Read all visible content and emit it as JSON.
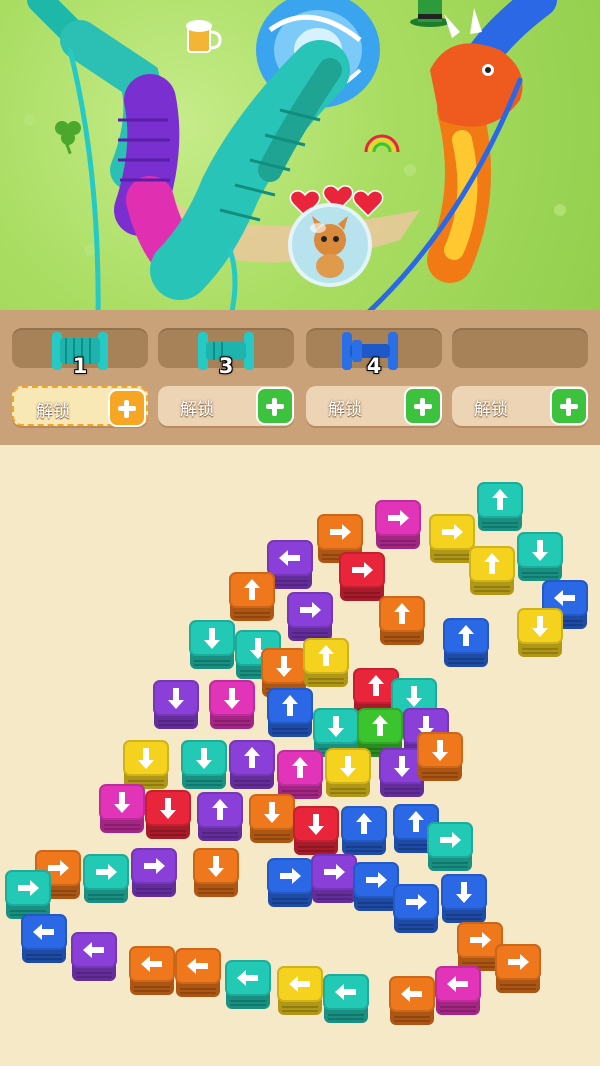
{
  "slots": [
    {
      "number": "1",
      "spool_color": "#26c9c4"
    },
    {
      "number": "3",
      "spool_color": "#26c9c4"
    },
    {
      "number": "4",
      "spool_color": "#2a6fe6"
    },
    {
      "number": "",
      "spool_color": ""
    }
  ],
  "unlock_buttons": [
    {
      "label": "解锁",
      "style": "orange"
    },
    {
      "label": "解锁",
      "style": "green"
    },
    {
      "label": "解锁",
      "style": "green"
    },
    {
      "label": "解锁",
      "style": "green"
    }
  ],
  "scene": {
    "hearts": 3,
    "character": "kitten-in-bubble",
    "decorations": [
      "shamrock-icon",
      "beer-mug-icon",
      "leprechaun-hat-icon",
      "rainbow-icon",
      "portal-swirl",
      "fire-dragon-head"
    ]
  },
  "colors": {
    "orange": "#f0781c",
    "yellow": "#f4d21e",
    "cyan": "#22c9b5",
    "purple": "#8a3fd8",
    "magenta": "#e234b8",
    "red": "#e8253a",
    "blue": "#2a68e6",
    "green": "#3cc42e",
    "arrow": "#ffffff"
  },
  "blocks": [
    {
      "c": "cyan",
      "d": "up"
    },
    {
      "c": "magenta",
      "d": "right"
    },
    {
      "c": "orange",
      "d": "right"
    },
    {
      "c": "yellow",
      "d": "right"
    },
    {
      "c": "cyan",
      "d": "down"
    },
    {
      "c": "purple",
      "d": "left"
    },
    {
      "c": "red",
      "d": "right"
    },
    {
      "c": "yellow",
      "d": "up"
    },
    {
      "c": "blue",
      "d": "left"
    },
    {
      "c": "orange",
      "d": "up"
    },
    {
      "c": "purple",
      "d": "right"
    },
    {
      "c": "orange",
      "d": "up"
    },
    {
      "c": "yellow",
      "d": "down"
    },
    {
      "c": "blue",
      "d": "up"
    },
    {
      "c": "cyan",
      "d": "down"
    },
    {
      "c": "cyan",
      "d": "down"
    },
    {
      "c": "orange",
      "d": "down"
    },
    {
      "c": "yellow",
      "d": "up"
    },
    {
      "c": "red",
      "d": "up"
    },
    {
      "c": "cyan",
      "d": "down"
    },
    {
      "c": "purple",
      "d": "down"
    },
    {
      "c": "magenta",
      "d": "down"
    },
    {
      "c": "blue",
      "d": "up"
    },
    {
      "c": "cyan",
      "d": "down"
    },
    {
      "c": "green",
      "d": "up"
    },
    {
      "c": "purple",
      "d": "down"
    },
    {
      "c": "yellow",
      "d": "down"
    },
    {
      "c": "cyan",
      "d": "down"
    },
    {
      "c": "purple",
      "d": "up"
    },
    {
      "c": "magenta",
      "d": "up"
    },
    {
      "c": "yellow",
      "d": "down"
    },
    {
      "c": "purple",
      "d": "down"
    },
    {
      "c": "orange",
      "d": "down"
    },
    {
      "c": "magenta",
      "d": "down"
    },
    {
      "c": "red",
      "d": "down"
    },
    {
      "c": "purple",
      "d": "up"
    },
    {
      "c": "orange",
      "d": "down"
    },
    {
      "c": "red",
      "d": "down"
    },
    {
      "c": "blue",
      "d": "up"
    },
    {
      "c": "blue",
      "d": "up"
    },
    {
      "c": "cyan",
      "d": "right"
    },
    {
      "c": "orange",
      "d": "right"
    },
    {
      "c": "cyan",
      "d": "right"
    },
    {
      "c": "purple",
      "d": "right"
    },
    {
      "c": "orange",
      "d": "down"
    },
    {
      "c": "blue",
      "d": "right"
    },
    {
      "c": "purple",
      "d": "right"
    },
    {
      "c": "blue",
      "d": "right"
    },
    {
      "c": "blue",
      "d": "right"
    },
    {
      "c": "blue",
      "d": "down"
    },
    {
      "c": "cyan",
      "d": "right"
    },
    {
      "c": "orange",
      "d": "right"
    },
    {
      "c": "blue",
      "d": "up"
    },
    {
      "c": "blue",
      "d": "left"
    },
    {
      "c": "purple",
      "d": "left"
    },
    {
      "c": "orange",
      "d": "left"
    },
    {
      "c": "orange",
      "d": "left"
    },
    {
      "c": "cyan",
      "d": "left"
    },
    {
      "c": "yellow",
      "d": "left"
    },
    {
      "c": "cyan",
      "d": "left"
    },
    {
      "c": "orange",
      "d": "left"
    },
    {
      "c": "magenta",
      "d": "left"
    },
    {
      "c": "orange",
      "d": "right"
    }
  ]
}
